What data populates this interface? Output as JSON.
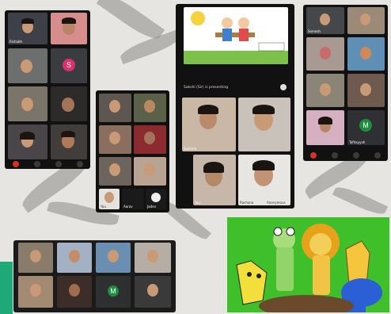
{
  "collage": {
    "phone_a": {
      "tiles": [
        {
          "label": "Rishabh"
        },
        {
          "label": ""
        },
        {
          "label": ""
        },
        {
          "label": "",
          "avatar": "S",
          "avatar_color": "#d6336c"
        },
        {
          "label": ""
        },
        {
          "label": ""
        },
        {
          "label": ""
        },
        {
          "label": ""
        }
      ]
    },
    "phone_b": {
      "tiles": [
        {
          "label": ""
        },
        {
          "label": ""
        },
        {
          "label": ""
        },
        {
          "label": ""
        },
        {
          "label": ""
        },
        {
          "label": ""
        },
        {
          "label": "You"
        },
        {
          "label": "Aarav"
        },
        {
          "label": "Jaden"
        }
      ]
    },
    "phone_c": {
      "presenter_caption": "Sakshi (Sir) is presenting",
      "tiles": [
        {
          "label": "Sushma"
        },
        {
          "label": ""
        },
        {
          "label": "You"
        },
        {
          "label": "Rachana"
        },
        {
          "label": "Anonymous"
        }
      ]
    },
    "phone_d": {
      "tiles": [
        {
          "label": "Somesh"
        },
        {
          "label": ""
        },
        {
          "label": ""
        },
        {
          "label": ""
        },
        {
          "label": ""
        },
        {
          "label": ""
        },
        {
          "label": ""
        },
        {
          "label": "Tafhayyah",
          "avatar": "M",
          "avatar_color": "#1e8e3e"
        }
      ]
    },
    "laptop": {
      "tiles": [
        {
          "label": ""
        },
        {
          "label": ""
        },
        {
          "label": ""
        },
        {
          "label": ""
        },
        {
          "label": ""
        },
        {
          "label": ""
        },
        {
          "label": "",
          "avatar": "M",
          "avatar_color": "#1e8e3e"
        },
        {
          "label": ""
        }
      ]
    }
  },
  "colors": {
    "meet_red": "#d93025",
    "craft_green": "#3fbf2a",
    "accent_teal": "#1fa878"
  }
}
